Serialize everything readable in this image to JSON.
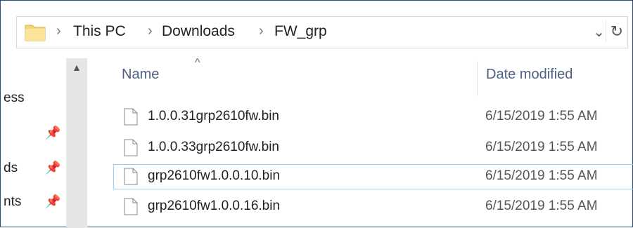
{
  "address": {
    "crumbs": [
      "This PC",
      "Downloads",
      "FW_grp"
    ],
    "separator": "›",
    "dropdown_icon": "chevron-down-icon",
    "refresh_icon": "refresh-icon"
  },
  "nav": {
    "items": [
      {
        "label": "ess",
        "pinned": false
      },
      {
        "label": "",
        "pinned": true
      },
      {
        "label": "ds",
        "pinned": true
      },
      {
        "label": "nts",
        "pinned": true
      }
    ]
  },
  "columns": {
    "name": "Name",
    "date_modified": "Date modified",
    "sort_indicator": "^"
  },
  "files": [
    {
      "name": "1.0.0.31grp2610fw.bin",
      "date": "6/15/2019 1:55 AM",
      "selected": false
    },
    {
      "name": "1.0.0.33grp2610fw.bin",
      "date": "6/15/2019 1:55 AM",
      "selected": false
    },
    {
      "name": "grp2610fw1.0.0.10.bin",
      "date": "6/15/2019 1:55 AM",
      "selected": true
    },
    {
      "name": "grp2610fw1.0.0.16.bin",
      "date": "6/15/2019 1:55 AM",
      "selected": false
    }
  ],
  "colors": {
    "selection_border": "#99c9f5",
    "header_text": "#4d6082",
    "folder_yellow": "#f8d775"
  }
}
